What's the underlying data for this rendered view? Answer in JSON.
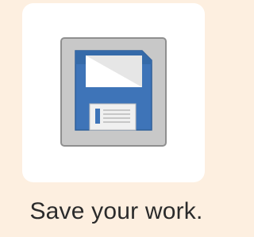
{
  "action": {
    "label": "Save your work.",
    "icon": "floppy-disk-icon"
  },
  "colors": {
    "background": "#fdefe0",
    "card": "#ffffff",
    "tile": "#c8c8c8",
    "disk": "#3e74b8"
  }
}
